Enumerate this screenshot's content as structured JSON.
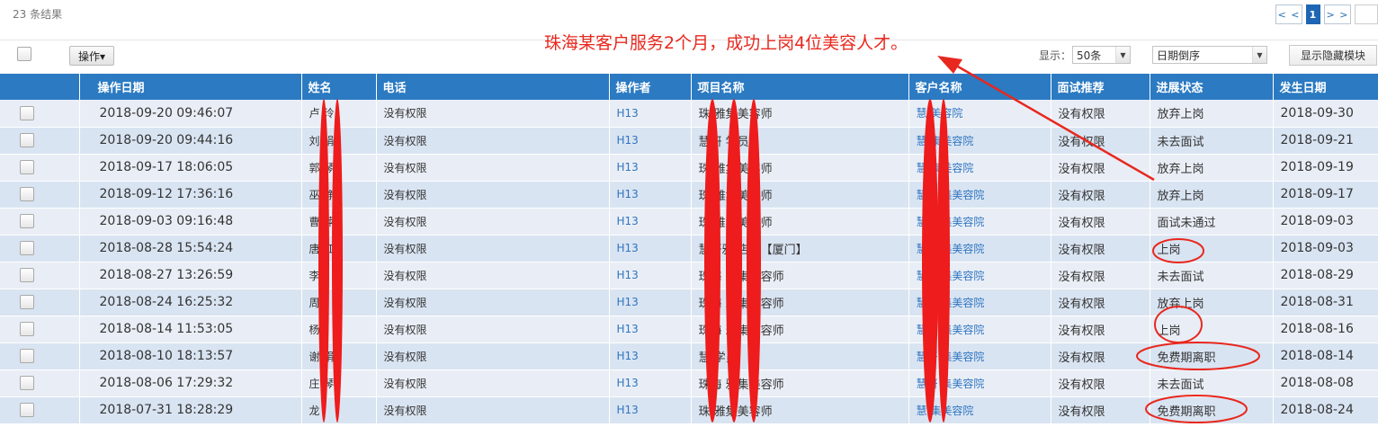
{
  "header": {
    "result_count": "23 条结果",
    "pager": {
      "prev": "< <",
      "current": "1",
      "next": "> >"
    }
  },
  "toolbar": {
    "operate_label": "操作▾",
    "display_label": "显示：",
    "page_size": "50条",
    "sort": "日期倒序",
    "toggle_label": "显示隐藏模块"
  },
  "annotation": {
    "note": "珠海某客户服务2个月，成功上岗4位美容人才。",
    "color": "#e8281e"
  },
  "table": {
    "columns": [
      "操作日期",
      "姓名",
      "电话",
      "操作者",
      "项目名称",
      "客户名称",
      "面试推荐",
      "进展状态",
      "发生日期"
    ],
    "rows": [
      {
        "date": "2018-09-20 09:46:07",
        "name": "卢 玲",
        "phone": "没有权限",
        "operator": "H13",
        "project": "珠 雅集美容师",
        "client": "慧 美容院",
        "interview": "没有权限",
        "status": "放弃上岗",
        "happen": "2018-09-30"
      },
      {
        "date": "2018-09-20 09:44:16",
        "name": "刘 娟",
        "phone": "没有权限",
        "operator": "H13",
        "project": "慧妍 学员",
        "client": "慧 集美容院",
        "interview": "没有权限",
        "status": "未去面试",
        "happen": "2018-09-21"
      },
      {
        "date": "2018-09-17 18:06:05",
        "name": "郭 琴",
        "phone": "没有权限",
        "operator": "H13",
        "project": "珠 雅集美容师",
        "client": "慧 集美容院",
        "interview": "没有权限",
        "status": "放弃上岗",
        "happen": "2018-09-19"
      },
      {
        "date": "2018-09-12 17:36:16",
        "name": "巫 静",
        "phone": "没有权限",
        "operator": "H13",
        "project": "珠 雅集美容师",
        "client": "慧妍 集美容院",
        "interview": "没有权限",
        "status": "放弃上岗",
        "happen": "2018-09-17"
      },
      {
        "date": "2018-09-03 09:16:48",
        "name": "曹 萍",
        "phone": "没有权限",
        "operator": "H13",
        "project": "珠 雅集美容师",
        "client": "慧妍 集美容院",
        "interview": "没有权限",
        "status": "面试未通过",
        "happen": "2018-09-03"
      },
      {
        "date": "2018-08-28 15:54:24",
        "name": "唐 红",
        "phone": "没有权限",
        "operator": "H13",
        "project": "慧妍雅 店长【厦门】",
        "client": "慧妍 集美容院",
        "interview": "没有权限",
        "status": "上岗",
        "happen": "2018-09-03"
      },
      {
        "date": "2018-08-27 13:26:59",
        "name": "李",
        "phone": "没有权限",
        "operator": "H13",
        "project": "珠海 雅集美容师",
        "client": "慧妍 集美容院",
        "interview": "没有权限",
        "status": "未去面试",
        "happen": "2018-08-29"
      },
      {
        "date": "2018-08-24 16:25:32",
        "name": "周",
        "phone": "没有权限",
        "operator": "H13",
        "project": "珠海 雅集美容师",
        "client": "慧妍 集美容院",
        "interview": "没有权限",
        "status": "放弃上岗",
        "happen": "2018-08-31"
      },
      {
        "date": "2018-08-14 11:53:05",
        "name": "杨",
        "phone": "没有权限",
        "operator": "H13",
        "project": "珠海 雅集美容师",
        "client": "慧妍 集美容院",
        "interview": "没有权限",
        "status": "上岗",
        "happen": "2018-08-16"
      },
      {
        "date": "2018-08-10 18:13:57",
        "name": "谢 娟",
        "phone": "没有权限",
        "operator": "H13",
        "project": "慧 学员",
        "client": "慧妍 集美容院",
        "interview": "没有权限",
        "status": "免费期离职",
        "happen": "2018-08-14"
      },
      {
        "date": "2018-08-06 17:29:32",
        "name": "庄 琴",
        "phone": "没有权限",
        "operator": "H13",
        "project": "珠海 雅集美容师",
        "client": "慧妍 集美容院",
        "interview": "没有权限",
        "status": "未去面试",
        "happen": "2018-08-08"
      },
      {
        "date": "2018-07-31 18:28:29",
        "name": "龙",
        "phone": "没有权限",
        "operator": "H13",
        "project": "珠 雅集美容师",
        "client": "慧 集美容院",
        "interview": "没有权限",
        "status": "免费期离职",
        "happen": "2018-08-24"
      }
    ]
  }
}
